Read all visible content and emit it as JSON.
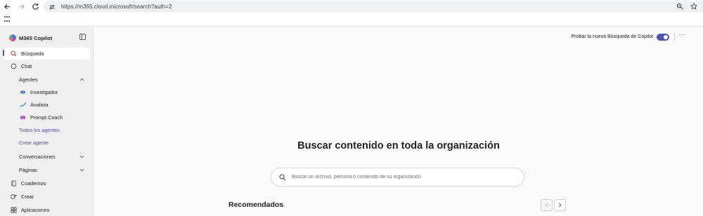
{
  "browser": {
    "url": "https://m365.cloud.microsoft/search?auth=2"
  },
  "sidebar": {
    "app_name": "M365 Copilot",
    "items": [
      {
        "label": "Búsqueda"
      },
      {
        "label": "Chat"
      },
      {
        "label": "Agentes"
      },
      {
        "label": "Investigador"
      },
      {
        "label": "Analista"
      },
      {
        "label": "Prompt Coach"
      },
      {
        "label": "Todos los agentes"
      },
      {
        "label": "Crear agente"
      },
      {
        "label": "Conversaciones"
      },
      {
        "label": "Páginas"
      },
      {
        "label": "Cuadernos"
      },
      {
        "label": "Crear"
      },
      {
        "label": "Aplicaciones"
      }
    ]
  },
  "header": {
    "toggle_label": "Probar la nueva Búsqueda de Copilot",
    "toggle_on": true,
    "more_label": "···"
  },
  "main": {
    "headline": "Buscar contenido en toda la organización",
    "search_placeholder": "Buscar un archivo, persona o contenido de su organización",
    "recommended_title": "Recomendados"
  },
  "colors": {
    "accent": "#4f52b2"
  }
}
